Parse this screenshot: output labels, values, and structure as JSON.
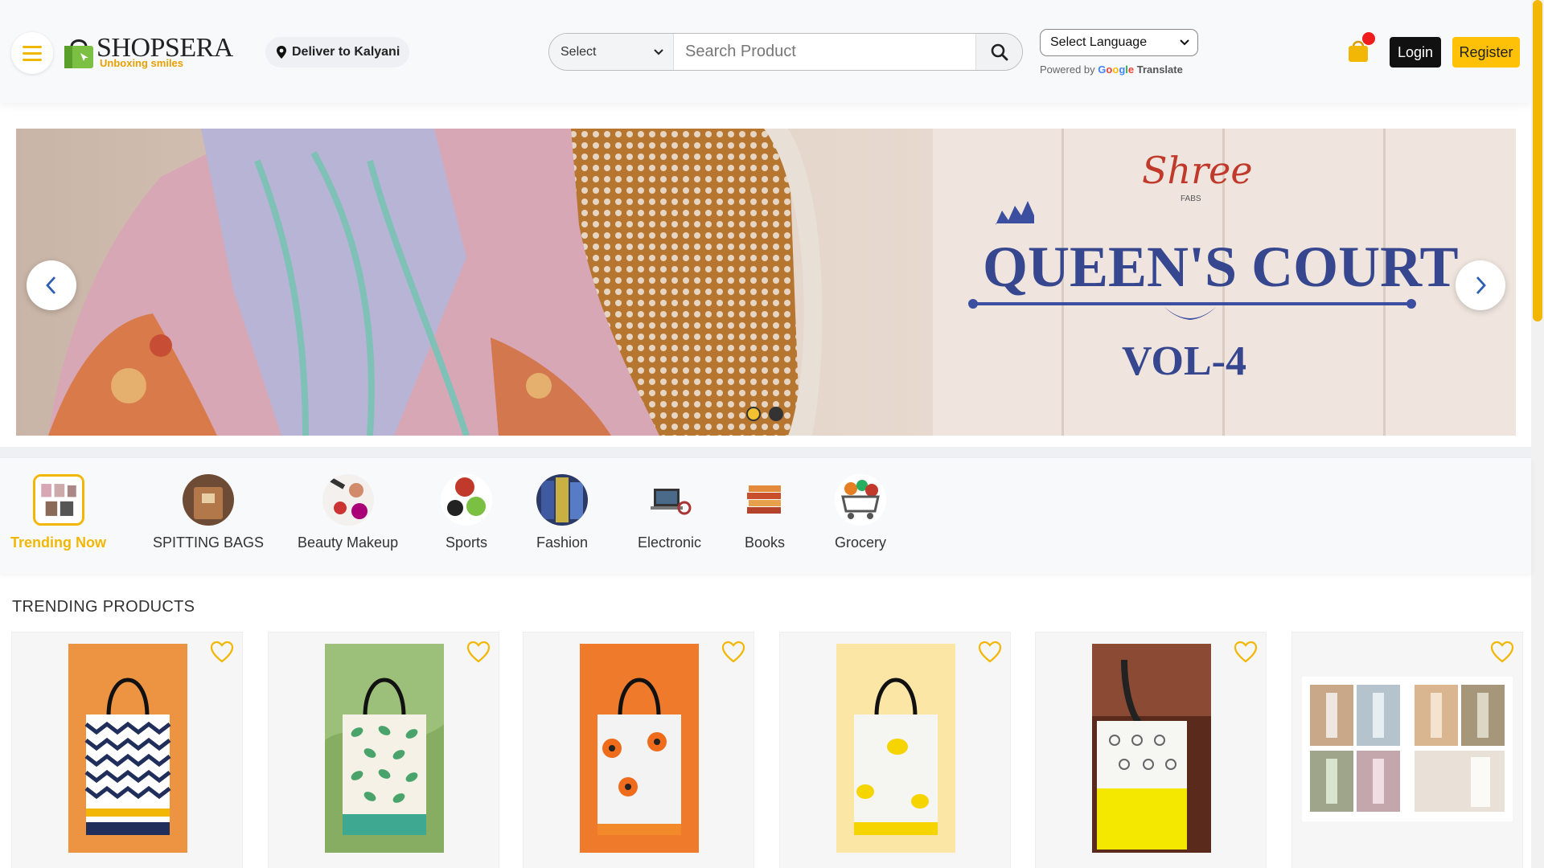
{
  "header": {
    "logo_name": "SHOPSERA",
    "logo_tagline": "Unboxing smiles",
    "deliver": "Deliver to Kalyani",
    "category_select": "Select",
    "search_placeholder": "Search Product",
    "language_select": "Select Language",
    "powered_by": "Powered by",
    "google_letters": [
      "G",
      "o",
      "o",
      "g",
      "l",
      "e"
    ],
    "translate": "Translate",
    "login": "Login",
    "register": "Register"
  },
  "banner": {
    "brand": "Shree",
    "brand_sub": "FABS",
    "title": "QUEEN'S COURT",
    "subtitle": "VOL-4",
    "active_slide": 1,
    "slide_count": 2
  },
  "categories": [
    {
      "label": "Trending Now",
      "active": true
    },
    {
      "label": "SPITTING BAGS",
      "active": false
    },
    {
      "label": "Beauty Makeup",
      "active": false
    },
    {
      "label": "Sports",
      "active": false
    },
    {
      "label": "Fashion",
      "active": false
    },
    {
      "label": "Electronic",
      "active": false
    },
    {
      "label": "Books",
      "active": false
    },
    {
      "label": "Grocery",
      "active": false
    }
  ],
  "trending": {
    "title": "TRENDING PRODUCTS",
    "products": [
      {
        "image": "tote-bag-chevron"
      },
      {
        "image": "tote-bag-leaves"
      },
      {
        "image": "tote-bag-flowers"
      },
      {
        "image": "tote-bag-bees"
      },
      {
        "image": "tote-bag-yoga"
      },
      {
        "image": "dress-collage"
      }
    ]
  },
  "colors": {
    "accent": "#f2b705",
    "cart_badge": "#f01d1d",
    "login_bg": "#111111",
    "register_bg": "#ffc107"
  },
  "icons": {
    "menu": "hamburger-icon",
    "location": "location-pin-icon",
    "search": "search-icon",
    "cart": "shopping-bag-icon",
    "favorite": "heart-icon",
    "prev": "chevron-left-icon",
    "next": "chevron-right-icon"
  }
}
